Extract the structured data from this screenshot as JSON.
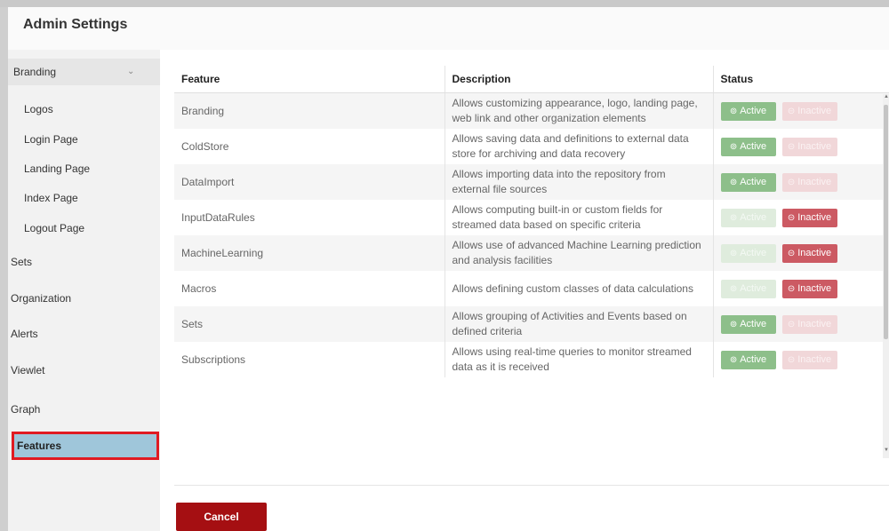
{
  "header": {
    "title": "Admin Settings"
  },
  "sidebar": {
    "branding": "Branding",
    "branding_sub": [
      "Logos",
      "Login Page",
      "Landing Page",
      "Index Page",
      "Logout Page"
    ],
    "items": [
      "Sets",
      "Organization",
      "Alerts",
      "Viewlet",
      "Graph"
    ],
    "selected": "Features"
  },
  "table": {
    "headers": {
      "feature": "Feature",
      "description": "Description",
      "status": "Status"
    },
    "active_label": "Active",
    "inactive_label": "Inactive",
    "rows": [
      {
        "feature": "Branding",
        "description": "Allows customizing appearance, logo, landing page, web link and other organization elements",
        "status": "Active"
      },
      {
        "feature": "ColdStore",
        "description": "Allows saving data and definitions to external data store for archiving and data recovery",
        "status": "Active"
      },
      {
        "feature": "DataImport",
        "description": "Allows importing data into the repository from external file sources",
        "status": "Active"
      },
      {
        "feature": "InputDataRules",
        "description": "Allows computing built-in or custom fields for streamed data based on specific criteria",
        "status": "Inactive"
      },
      {
        "feature": "MachineLearning",
        "description": "Allows use of advanced Machine Learning prediction and analysis facilities",
        "status": "Inactive"
      },
      {
        "feature": "Macros",
        "description": "Allows defining custom classes of data calculations",
        "status": "Inactive"
      },
      {
        "feature": "Sets",
        "description": "Allows grouping of Activities and Events based on defined criteria",
        "status": "Active"
      },
      {
        "feature": "Subscriptions",
        "description": "Allows using real-time queries to monitor streamed data as it is received",
        "status": "Active"
      }
    ]
  },
  "footer": {
    "cancel_label": "Cancel"
  },
  "colors": {
    "accent": "#a50f12",
    "active": "#8dbf8a",
    "inactive": "#cc5a63",
    "selected_bg": "#9fc6da",
    "highlight_border": "#e01b22"
  }
}
